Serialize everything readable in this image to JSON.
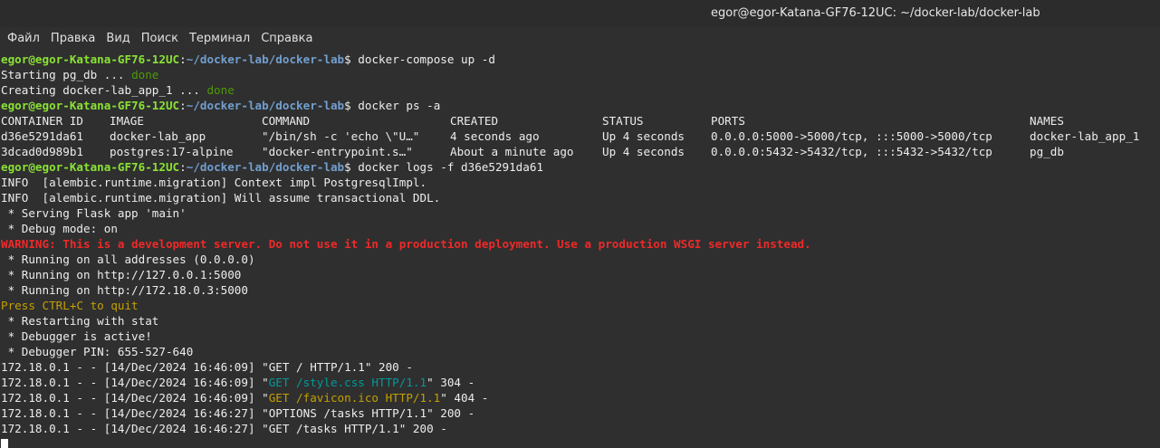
{
  "window": {
    "title": "egor@egor-Katana-GF76-12UC: ~/docker-lab/docker-lab"
  },
  "menu": [
    "Файл",
    "Правка",
    "Вид",
    "Поиск",
    "Терминал",
    "Справка"
  ],
  "prompt": {
    "user_host": "egor@egor-Katana-GF76-12UC",
    "sep": ":",
    "path": "~/docker-lab/docker-lab",
    "dollar": "$ "
  },
  "commands": {
    "cmd1": "docker-compose up -d",
    "cmd2": "docker ps -a",
    "cmd3": "docker logs -f d36e5291da61"
  },
  "compose_output": [
    {
      "text": "Starting pg_db ... ",
      "status": "done"
    },
    {
      "text": "Creating docker-lab_app_1 ... ",
      "status": "done"
    }
  ],
  "ps_table": {
    "headers": [
      "CONTAINER ID",
      "IMAGE",
      "COMMAND",
      "CREATED",
      "STATUS",
      "PORTS",
      "NAMES"
    ],
    "rows": [
      [
        "d36e5291da61",
        "docker-lab_app",
        "\"/bin/sh -c 'echo \\\"U…\"",
        "4 seconds ago",
        "Up 4 seconds",
        "0.0.0.0:5000->5000/tcp, :::5000->5000/tcp",
        "docker-lab_app_1"
      ],
      [
        "3dcad0d989b1",
        "postgres:17-alpine",
        "\"docker-entrypoint.s…\"",
        "About a minute ago",
        "Up 4 seconds",
        "0.0.0.0:5432->5432/tcp, :::5432->5432/tcp",
        "pg_db"
      ]
    ]
  },
  "logs": {
    "info1": "INFO  [alembic.runtime.migration] Context impl PostgresqlImpl.",
    "info2": "INFO  [alembic.runtime.migration] Will assume transactional DDL.",
    "serving": " * Serving Flask app 'main'",
    "debug_mode": " * Debug mode: on",
    "warning": "WARNING: This is a development server. Do not use it in a production deployment. Use a production WSGI server instead.",
    "running_all": " * Running on all addresses (0.0.0.0)",
    "running_local": " * Running on http://127.0.0.1:5000",
    "running_net": " * Running on http://172.18.0.3:5000",
    "quit": "Press CTRL+C to quit",
    "restarting": " * Restarting with stat",
    "debugger_active": " * Debugger is active!",
    "debugger_pin": " * Debugger PIN: 655-527-640",
    "req1": "172.18.0.1 - - [14/Dec/2024 16:46:09] \"GET / HTTP/1.1\" 200 -",
    "req2_pre": "172.18.0.1 - - [14/Dec/2024 16:46:09] \"",
    "req2_hl": "GET /style.css HTTP/1.1",
    "req2_post": "\" 304 -",
    "req3_pre": "172.18.0.1 - - [14/Dec/2024 16:46:09] \"",
    "req3_hl": "GET /favicon.ico HTTP/1.1",
    "req3_post": "\" 404 -",
    "req4": "172.18.0.1 - - [14/Dec/2024 16:46:27] \"OPTIONS /tasks HTTP/1.1\" 200 -",
    "req5": "172.18.0.1 - - [14/Dec/2024 16:46:27] \"GET /tasks HTTP/1.1\" 200 -"
  },
  "colors": {
    "background": "#2f2f2f",
    "prompt_user": "#8ae234",
    "prompt_path": "#729fcf",
    "done": "#4e9a06",
    "warning": "#ef2929",
    "quit": "#c4a000",
    "cyan_304": "#06989a"
  }
}
